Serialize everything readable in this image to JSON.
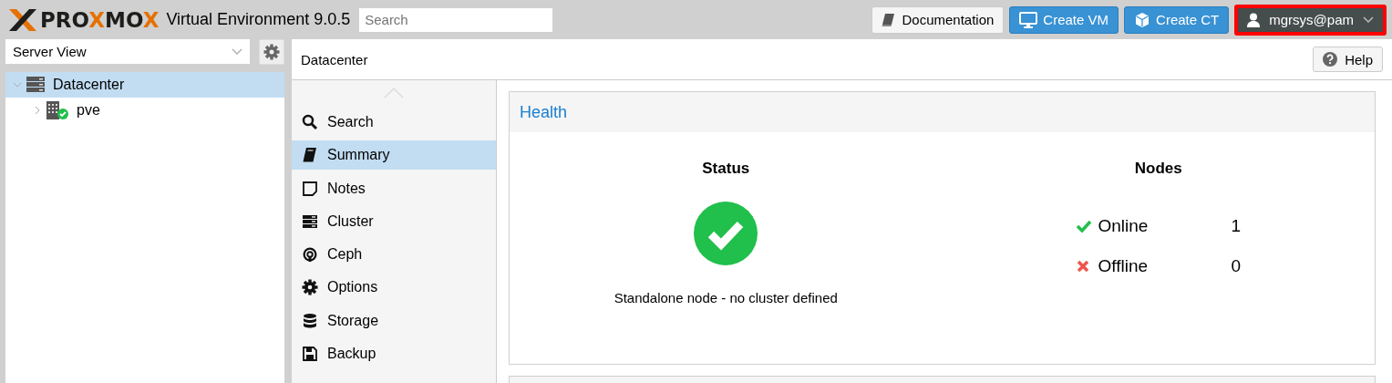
{
  "header": {
    "logo_parts": [
      {
        "text": "PRO",
        "accent": false
      },
      {
        "text": "X",
        "accent": true
      },
      {
        "text": "MO",
        "accent": false
      },
      {
        "text": "X",
        "accent": true
      }
    ],
    "product": "Virtual Environment 9.0.5",
    "search": {
      "placeholder": "Search"
    },
    "buttons": [
      {
        "kind": "doc",
        "label": "Documentation"
      },
      {
        "kind": "vm",
        "label": "Create VM"
      },
      {
        "kind": "ct",
        "label": "Create CT"
      }
    ],
    "user": {
      "label": "mgrsys@pam",
      "highlighted": true
    }
  },
  "sidebar": {
    "view": "Server View",
    "tree": [
      {
        "label": "Datacenter",
        "kind": "datacenter",
        "expanded": true,
        "selected": true,
        "children": [
          {
            "label": "pve",
            "kind": "node",
            "expanded": false,
            "selected": false
          }
        ]
      }
    ]
  },
  "panel": {
    "title": "Datacenter",
    "help": "Help",
    "nav": [
      {
        "label": "Search",
        "kind": "search",
        "selected": false
      },
      {
        "label": "Summary",
        "kind": "book",
        "selected": true
      },
      {
        "label": "Notes",
        "kind": "note",
        "selected": false
      },
      {
        "label": "Cluster",
        "kind": "cluster",
        "selected": false
      },
      {
        "label": "Ceph",
        "kind": "ceph",
        "selected": false
      },
      {
        "label": "Options",
        "kind": "gear",
        "selected": false
      },
      {
        "label": "Storage",
        "kind": "db",
        "selected": false
      },
      {
        "label": "Backup",
        "kind": "save",
        "selected": false
      }
    ],
    "health": {
      "title": "Health",
      "status_title": "Status",
      "status_ok": true,
      "status_text": "Standalone node - no cluster defined",
      "nodes_title": "Nodes",
      "nodes": [
        {
          "kind": "online",
          "label": "Online",
          "count": "1"
        },
        {
          "kind": "offline",
          "label": "Offline",
          "count": "0"
        }
      ]
    }
  }
}
